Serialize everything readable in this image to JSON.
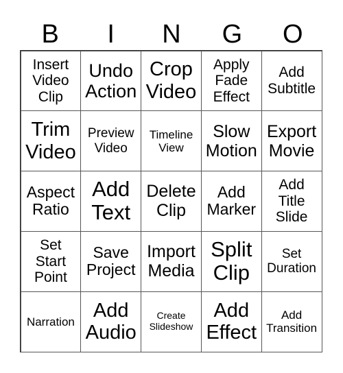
{
  "header": [
    "B",
    "I",
    "N",
    "G",
    "O"
  ],
  "cells": [
    [
      "Insert\nVideo\nClip",
      "Undo\nAction",
      "Crop\nVideo",
      "Apply\nFade\nEffect",
      "Add\nSubtitle"
    ],
    [
      "Trim\nVideo",
      "Preview\nVideo",
      "Timeline\nView",
      "Slow\nMotion",
      "Export\nMovie"
    ],
    [
      "Aspect\nRatio",
      "Add\nText",
      "Delete\nClip",
      "Add\nMarker",
      "Add\nTitle\nSlide"
    ],
    [
      "Set\nStart\nPoint",
      "Save\nProject",
      "Import\nMedia",
      "Split\nClip",
      "Set\nDuration"
    ],
    [
      "Narration",
      "Add\nAudio",
      "Create\nSlideshow",
      "Add\nEffect",
      "Add\nTransition"
    ]
  ]
}
